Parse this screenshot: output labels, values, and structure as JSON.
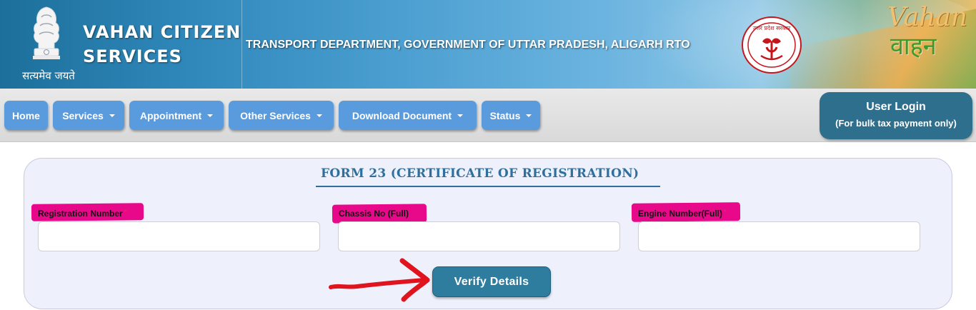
{
  "header": {
    "emblem_motto": "सत्यमेव जयते",
    "site_title_line1": "VAHAN CITIZEN",
    "site_title_line2": "SERVICES",
    "department": "TRANSPORT DEPARTMENT, GOVERNMENT OF UTTAR PRADESH, ALIGARH RTO",
    "state_logo_text": "उत्तर प्रदेश सरकार",
    "vahan_logo_en": "Vahan",
    "vahan_logo_hi": "वाहन"
  },
  "nav": {
    "items": [
      {
        "label": "Home",
        "dropdown": false
      },
      {
        "label": "Services",
        "dropdown": true
      },
      {
        "label": "Appointment",
        "dropdown": true
      },
      {
        "label": "Other Services",
        "dropdown": true
      },
      {
        "label": "Download Document",
        "dropdown": true
      },
      {
        "label": "Status",
        "dropdown": true
      }
    ],
    "user_login": {
      "line1": "User Login",
      "line2": "(For bulk tax payment only)"
    }
  },
  "form": {
    "title": "FORM 23 (CERTIFICATE OF REGISTRATION)",
    "fields": [
      {
        "label": "Registration Number",
        "required": true,
        "value": "",
        "placeholder": ""
      },
      {
        "label": "Chassis No (Full)",
        "required": false,
        "value": "",
        "placeholder": ""
      },
      {
        "label": "Engine Number(Full)",
        "required": true,
        "value": "",
        "placeholder": ""
      }
    ],
    "required_marker": "*",
    "submit_label": "Verify Details"
  },
  "annotations": {
    "highlight_color": "#e8088a",
    "arrow_color": "#e0141e"
  },
  "colors": {
    "nav_button": "#5a9bdd",
    "user_login": "#2e6f8e",
    "verify_button": "#2e7d9e",
    "form_title": "#2e6f9e",
    "panel_bg": "#eef0fb"
  }
}
